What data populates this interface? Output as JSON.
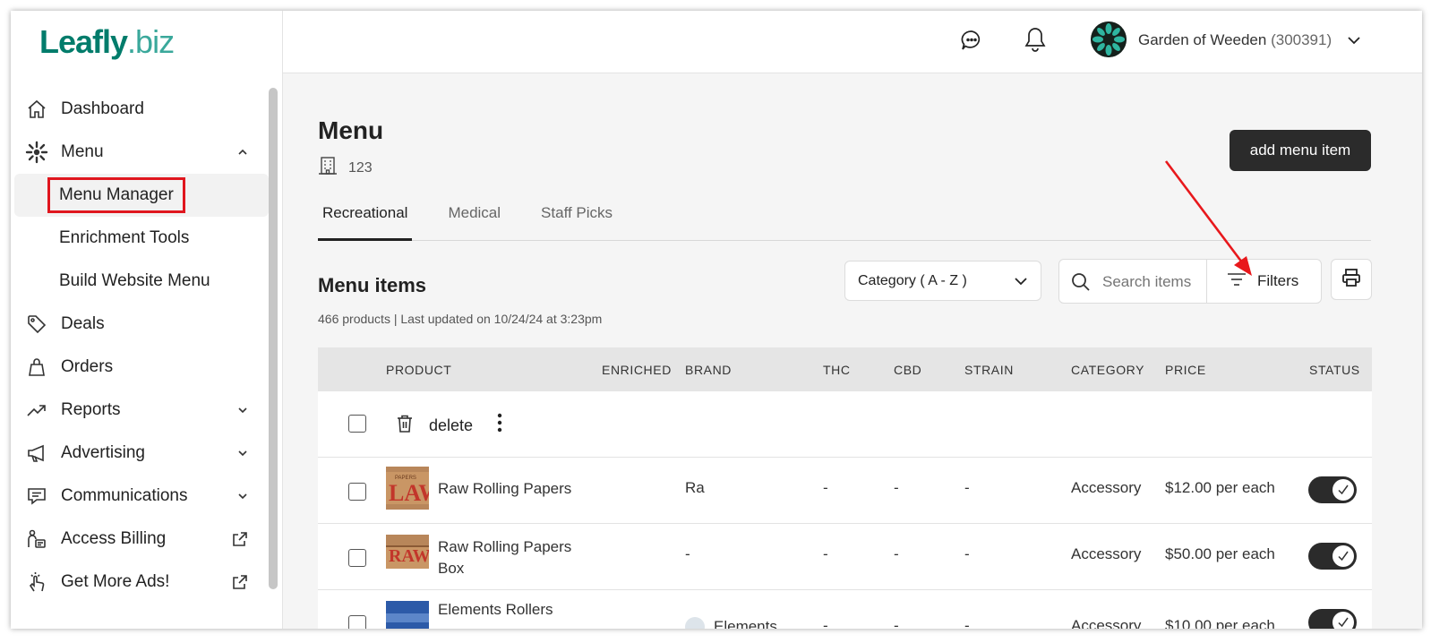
{
  "brand": {
    "logo_main": "Leafly",
    "logo_suffix": ".biz"
  },
  "sidebar": {
    "items": [
      {
        "label": "Dashboard",
        "icon": "home-icon"
      },
      {
        "label": "Menu",
        "icon": "menu-leaf-icon",
        "expanded": true
      },
      {
        "label": "Menu Manager",
        "sub": true,
        "active": true
      },
      {
        "label": "Enrichment Tools",
        "sub": true
      },
      {
        "label": "Build Website Menu",
        "sub": true
      },
      {
        "label": "Deals",
        "icon": "tag-icon"
      },
      {
        "label": "Orders",
        "icon": "bag-icon"
      },
      {
        "label": "Reports",
        "icon": "trend-icon"
      },
      {
        "label": "Advertising",
        "icon": "megaphone-icon"
      },
      {
        "label": "Communications",
        "icon": "message-icon"
      },
      {
        "label": "Access Billing",
        "icon": "billing-icon"
      },
      {
        "label": "Get More Ads!",
        "icon": "pointer-icon"
      }
    ]
  },
  "header": {
    "store_name": "Garden of Weeden",
    "store_id": "(300391)"
  },
  "page": {
    "title": "Menu",
    "store_number": "123",
    "add_button": "add menu item",
    "tabs": [
      {
        "label": "Recreational",
        "active": true
      },
      {
        "label": "Medical"
      },
      {
        "label": "Staff Picks"
      }
    ],
    "section_title": "Menu items",
    "section_meta": "466 products | Last updated on 10/24/24 at 3:23pm",
    "sort_value": "Category ( A - Z )",
    "search_placeholder": "Search items",
    "filters_label": "Filters"
  },
  "table": {
    "columns": [
      "PRODUCT",
      "ENRICHED",
      "BRAND",
      "THC",
      "CBD",
      "STRAIN",
      "CATEGORY",
      "PRICE",
      "STATUS"
    ],
    "bulk_delete_label": "delete",
    "rows": [
      {
        "name": "Raw Rolling Papers",
        "brand": "Ra",
        "thc": "-",
        "cbd": "-",
        "strain": "-",
        "category": "Accessory",
        "price": "$12.00 per each"
      },
      {
        "name_line1": "Raw Rolling Papers",
        "name_line2": "Box",
        "brand": "-",
        "thc": "-",
        "cbd": "-",
        "strain": "-",
        "category": "Accessory",
        "price": "$50.00 per each"
      },
      {
        "name": "Elements Rollers",
        "brand": "Elements",
        "thc": "-",
        "cbd": "-",
        "strain": "-",
        "category": "Accessory",
        "price": "$10.00 per each"
      }
    ]
  },
  "colors": {
    "brand": "#017c6b",
    "highlight": "#e0161e",
    "arrow": "#e8181c"
  }
}
